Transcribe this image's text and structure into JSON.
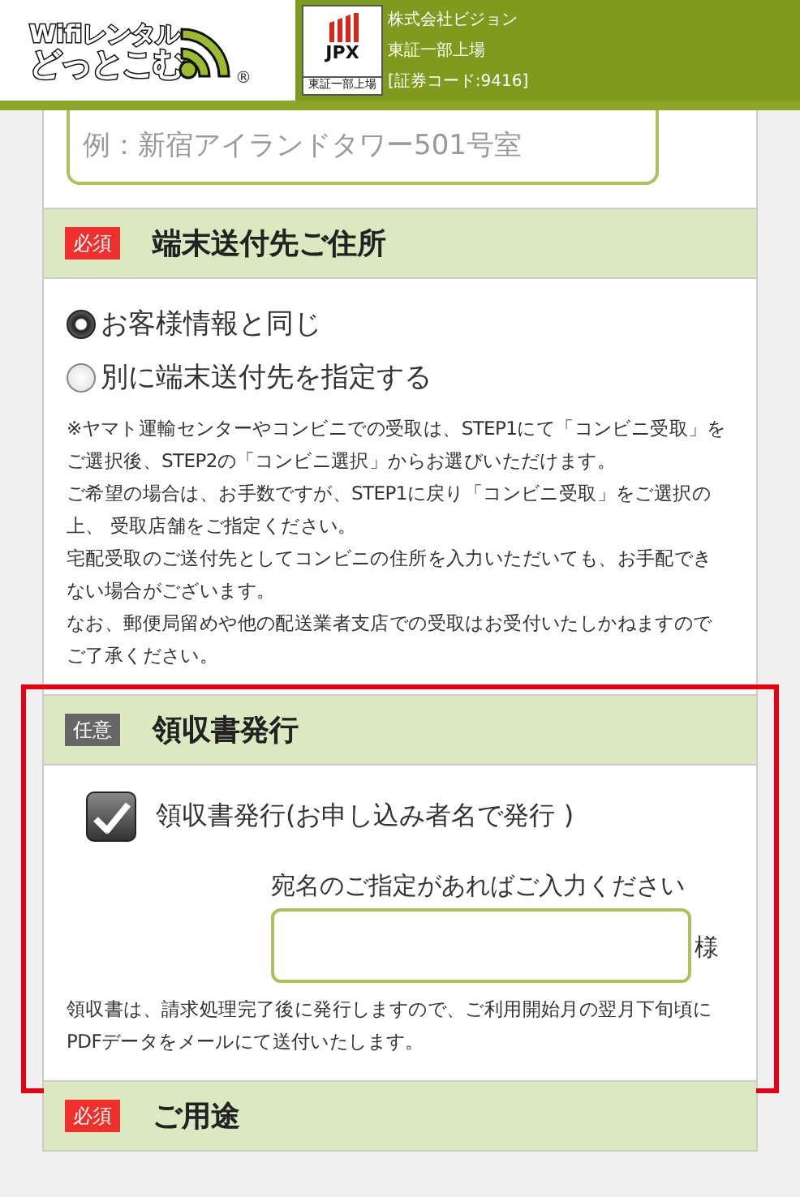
{
  "header": {
    "logo": {
      "line_1": "Wifiレンタル",
      "line_2": "どっとこむ",
      "mark": "®"
    },
    "listing_badge": {
      "name": "JPX",
      "caption": "東証一部上場"
    },
    "company": [
      "株式会社ビジョン",
      "東証一部上場",
      "[証券コード:9416]"
    ]
  },
  "top_field": {
    "placeholder": "例：新宿アイランドタワー501号室"
  },
  "sections": [
    {
      "kind": "address",
      "badge": {
        "label": "必須",
        "kind": "required"
      },
      "title": "端末送付先ご住所",
      "highlighted": false,
      "radios": [
        {
          "label": "お客様情報と同じ",
          "selected": true
        },
        {
          "label": "別に端末送付先を指定する",
          "selected": false
        }
      ],
      "notes": [
        "※ヤマト運輸センターやコンビニでの受取は、STEP1にて「コンビニ受取」をご選択後、STEP2の「コンビニ選択」からお選びいただけます。",
        "ご希望の場合は、お手数ですが、STEP1に戻り「コンビニ受取」をご選択の上、 受取店舗をご指定ください。",
        "宅配受取のご送付先としてコンビニの住所を入力いただいても、お手配できない場合がございます。",
        "なお、郵便局留めや他の配送業者支店での受取はお受付いたしかねますのでご了承ください。"
      ]
    },
    {
      "kind": "receipt",
      "badge": {
        "label": "任意",
        "kind": "optional"
      },
      "title": "領収書発行",
      "highlighted": true,
      "checkbox": {
        "label": "領収書発行(お申し込み者名で発行 )",
        "checked": true
      },
      "addressee": {
        "hint": "宛名のご指定があればご入力ください",
        "suffix": "様"
      },
      "notes": [
        "領収書は、請求処理完了後に発行しますので、ご利用開始月の翌月下旬頃にPDFデータをメールにて送付いたします。"
      ]
    },
    {
      "kind": "heading",
      "badge": {
        "label": "必須",
        "kind": "required"
      },
      "title": "ご用途",
      "highlighted": false
    }
  ]
}
